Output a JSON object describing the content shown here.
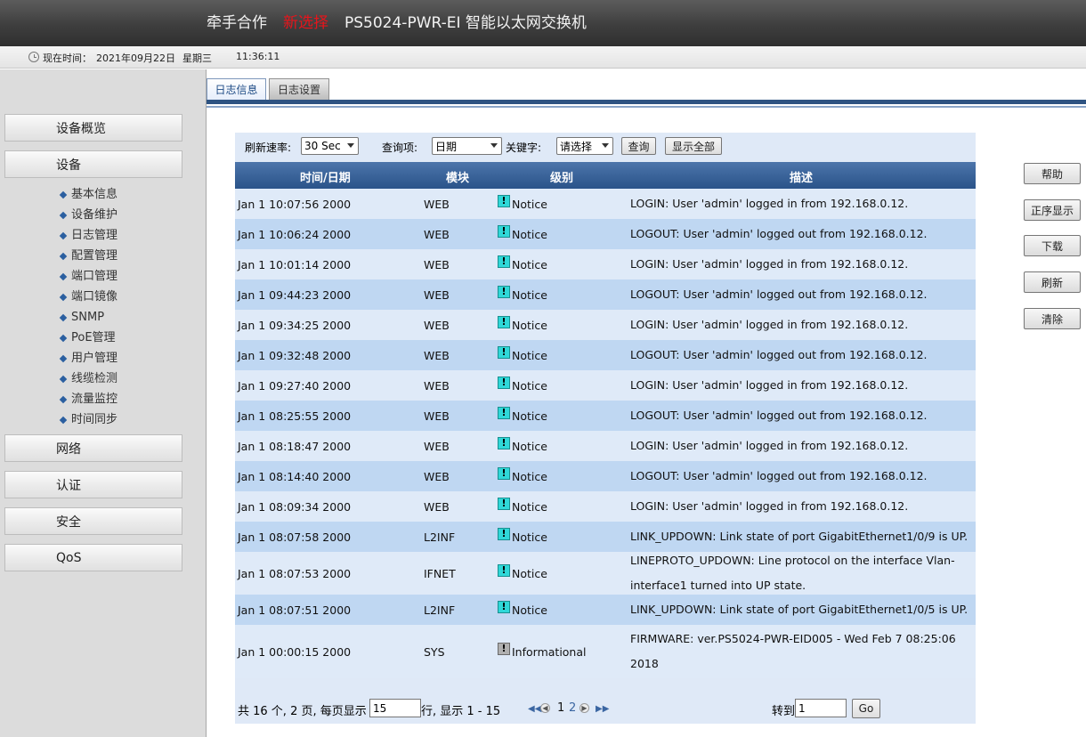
{
  "header": {
    "brand_a": "牵手合作",
    "brand_b": "新选择",
    "brand_c": "PS5024-PWR-EI 智能以太网交换机"
  },
  "timebar": {
    "label": "现在时间：",
    "date": "2021年09月22日",
    "weekday": "星期三",
    "time": "11:36:11"
  },
  "sidebar": {
    "sections": [
      "设备概览",
      "设备",
      "网络",
      "认证",
      "安全",
      "QoS"
    ],
    "device_items": [
      "基本信息",
      "设备维护",
      "日志管理",
      "配置管理",
      "端口管理",
      "端口镜像",
      "SNMP",
      "PoE管理",
      "用户管理",
      "线缆检测",
      "流量监控",
      "时间同步"
    ]
  },
  "tabs": [
    "日志信息",
    "日志设置"
  ],
  "filters": {
    "refresh_label": "刷新速率:",
    "refresh_value": "30 Sec",
    "query_label": "查询项:",
    "query_value": "日期",
    "keyword_label": "关键字:",
    "keyword_value": "请选择",
    "query_button": "查询",
    "show_all_button": "显示全部"
  },
  "table": {
    "headers": [
      "时间/日期",
      "模块",
      "级别",
      "描述"
    ],
    "rows": [
      {
        "time": "Jan 1 10:07:56 2000",
        "module": "WEB",
        "level": "Notice",
        "desc": "LOGIN: User 'admin' logged in from 192.168.0.12."
      },
      {
        "time": "Jan 1 10:06:24 2000",
        "module": "WEB",
        "level": "Notice",
        "desc": "LOGOUT: User 'admin' logged out from 192.168.0.12."
      },
      {
        "time": "Jan 1 10:01:14 2000",
        "module": "WEB",
        "level": "Notice",
        "desc": "LOGIN: User 'admin' logged in from 192.168.0.12."
      },
      {
        "time": "Jan 1 09:44:23 2000",
        "module": "WEB",
        "level": "Notice",
        "desc": "LOGOUT: User 'admin' logged out from 192.168.0.12."
      },
      {
        "time": "Jan 1 09:34:25 2000",
        "module": "WEB",
        "level": "Notice",
        "desc": "LOGIN: User 'admin' logged in from 192.168.0.12."
      },
      {
        "time": "Jan 1 09:32:48 2000",
        "module": "WEB",
        "level": "Notice",
        "desc": "LOGOUT: User 'admin' logged out from 192.168.0.12."
      },
      {
        "time": "Jan 1 09:27:40 2000",
        "module": "WEB",
        "level": "Notice",
        "desc": "LOGIN: User 'admin' logged in from 192.168.0.12."
      },
      {
        "time": "Jan 1 08:25:55 2000",
        "module": "WEB",
        "level": "Notice",
        "desc": "LOGOUT: User 'admin' logged out from 192.168.0.12."
      },
      {
        "time": "Jan 1 08:18:47 2000",
        "module": "WEB",
        "level": "Notice",
        "desc": "LOGIN: User 'admin' logged in from 192.168.0.12."
      },
      {
        "time": "Jan 1 08:14:40 2000",
        "module": "WEB",
        "level": "Notice",
        "desc": "LOGOUT: User 'admin' logged out from 192.168.0.12."
      },
      {
        "time": "Jan 1 08:09:34 2000",
        "module": "WEB",
        "level": "Notice",
        "desc": "LOGIN: User 'admin' logged in from 192.168.0.12."
      },
      {
        "time": "Jan 1 08:07:58 2000",
        "module": "L2INF",
        "level": "Notice",
        "desc": "LINK_UPDOWN: Link state of port GigabitEthernet1/0/9 is UP."
      },
      {
        "time": "Jan 1 08:07:53 2000",
        "module": "IFNET",
        "level": "Notice",
        "desc": "LINEPROTO_UPDOWN: Line protocol on the interface Vlan-interface1 turned into UP state."
      },
      {
        "time": "Jan 1 08:07:51 2000",
        "module": "L2INF",
        "level": "Notice",
        "desc": "LINK_UPDOWN: Link state of port GigabitEthernet1/0/5 is UP."
      },
      {
        "time": "Jan 1 00:00:15 2000",
        "module": "SYS",
        "level": "Informational",
        "desc": "FIRMWARE: ver.PS5024-PWR-EID005 - Wed Feb 7 08:25:06 2018"
      }
    ]
  },
  "pager": {
    "summary_a": "共 16 个, 2 页, 每页显示",
    "per_page": "15",
    "summary_b": "行, 显示 1 - 15",
    "page_1": "1",
    "page_2": "2",
    "goto_label": "转到",
    "goto_value": "1",
    "go_button": "Go"
  },
  "actions": [
    "帮助",
    "正序显示",
    "下载",
    "刷新",
    "清除"
  ]
}
